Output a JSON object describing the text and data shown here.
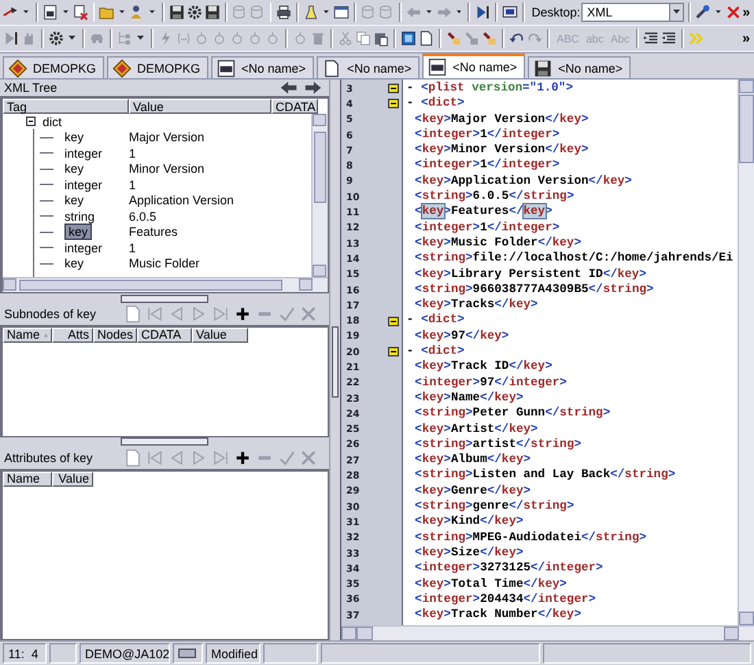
{
  "toolbar": {
    "desktop_label": "Desktop:",
    "desktop_value": "XML",
    "case_buttons": [
      {
        "label": "ABC",
        "disabled": true
      },
      {
        "label": "abc",
        "disabled": true
      },
      {
        "label": "Abc",
        "disabled": true
      }
    ],
    "overflow": [
      "»",
      "»"
    ]
  },
  "tabs": [
    {
      "label": "DEMOPKG",
      "kind": "package",
      "selected": false
    },
    {
      "label": "DEMOPKG",
      "kind": "package",
      "selected": false
    },
    {
      "label": "<No name>",
      "kind": "xml",
      "selected": false
    },
    {
      "label": "<No name>",
      "kind": "document",
      "selected": false
    },
    {
      "label": "<No name>",
      "kind": "xml",
      "selected": true
    },
    {
      "label": "<No name>",
      "kind": "database",
      "selected": false
    }
  ],
  "xml_tree": {
    "title": "XML Tree",
    "columns": [
      "Tag",
      "Value",
      "CDATA"
    ],
    "nodes": [
      {
        "tag": "dict",
        "expanded": true,
        "selected": false,
        "children": [
          {
            "tag": "key",
            "value": "Major Version",
            "selected": false
          },
          {
            "tag": "integer",
            "value": "1",
            "selected": false
          },
          {
            "tag": "key",
            "value": "Minor Version",
            "selected": false
          },
          {
            "tag": "integer",
            "value": "1",
            "selected": false
          },
          {
            "tag": "key",
            "value": "Application Version",
            "selected": false
          },
          {
            "tag": "string",
            "value": "6.0.5",
            "selected": false
          },
          {
            "tag": "key",
            "value": "Features",
            "selected": true
          },
          {
            "tag": "integer",
            "value": "1",
            "selected": false
          },
          {
            "tag": "key",
            "value": "Music Folder",
            "selected": false
          }
        ]
      }
    ]
  },
  "subnodes": {
    "title": "Subnodes of key",
    "columns": [
      {
        "label": "Name",
        "sorted": true
      },
      {
        "label": "Atts",
        "sorted": false
      },
      {
        "label": "Nodes",
        "sorted": false
      },
      {
        "label": "CDATA",
        "sorted": false
      },
      {
        "label": "Value",
        "sorted": false
      }
    ]
  },
  "attributes": {
    "title": "Attributes of key",
    "columns": [
      {
        "label": "Name",
        "sorted": false
      },
      {
        "label": "Value",
        "sorted": false
      }
    ]
  },
  "editor": {
    "lines": [
      {
        "number": "3",
        "text": "- <plist version=\"1.0\">",
        "collapsible": true,
        "match": false
      },
      {
        "number": "4",
        "text": "- <dict>",
        "collapsible": true,
        "match": false
      },
      {
        "number": "5",
        "text": "<key>Major Version</key>",
        "collapsible": false,
        "match": false
      },
      {
        "number": "6",
        "text": "<integer>1</integer>",
        "collapsible": false,
        "match": false
      },
      {
        "number": "7",
        "text": "<key>Minor Version</key>",
        "collapsible": false,
        "match": false
      },
      {
        "number": "8",
        "text": "<integer>1</integer>",
        "collapsible": false,
        "match": false
      },
      {
        "number": "9",
        "text": "<key>Application Version</key>",
        "collapsible": false,
        "match": false
      },
      {
        "number": "10",
        "text": "<string>6.0.5</string>",
        "collapsible": false,
        "match": false
      },
      {
        "number": "11",
        "text": "<key>Features</key>",
        "collapsible": false,
        "match": true
      },
      {
        "number": "12",
        "text": "<integer>1</integer>",
        "collapsible": false,
        "match": false
      },
      {
        "number": "13",
        "text": "<key>Music Folder</key>",
        "collapsible": false,
        "match": false
      },
      {
        "number": "14",
        "text": "<string>file://localhost/C:/home/jahrends/Ei",
        "collapsible": false,
        "match": false
      },
      {
        "number": "15",
        "text": "<key>Library Persistent ID</key>",
        "collapsible": false,
        "match": false
      },
      {
        "number": "16",
        "text": "<string>966038777A4309B5</string>",
        "collapsible": false,
        "match": false
      },
      {
        "number": "17",
        "text": "<key>Tracks</key>",
        "collapsible": false,
        "match": false
      },
      {
        "number": "18",
        "text": "- <dict>",
        "collapsible": true,
        "match": false
      },
      {
        "number": "19",
        "text": "<key>97</key>",
        "collapsible": false,
        "match": false
      },
      {
        "number": "20",
        "text": "- <dict>",
        "collapsible": true,
        "match": false
      },
      {
        "number": "21",
        "text": "<key>Track ID</key>",
        "collapsible": false,
        "match": false
      },
      {
        "number": "22",
        "text": "<integer>97</integer>",
        "collapsible": false,
        "match": false
      },
      {
        "number": "23",
        "text": "<key>Name</key>",
        "collapsible": false,
        "match": false
      },
      {
        "number": "24",
        "text": "<string>Peter Gunn</string>",
        "collapsible": false,
        "match": false
      },
      {
        "number": "25",
        "text": "<key>Artist</key>",
        "collapsible": false,
        "match": false
      },
      {
        "number": "26",
        "text": "<string>artist</string>",
        "collapsible": false,
        "match": false
      },
      {
        "number": "27",
        "text": "<key>Album</key>",
        "collapsible": false,
        "match": false
      },
      {
        "number": "28",
        "text": "<string>Listen and Lay Back</string>",
        "collapsible": false,
        "match": false
      },
      {
        "number": "29",
        "text": "<key>Genre</key>",
        "collapsible": false,
        "match": false
      },
      {
        "number": "30",
        "text": "<string>genre</string>",
        "collapsible": false,
        "match": false
      },
      {
        "number": "31",
        "text": "<key>Kind</key>",
        "collapsible": false,
        "match": false
      },
      {
        "number": "32",
        "text": "<string>MPEG-Audiodatei</string>",
        "collapsible": false,
        "match": false
      },
      {
        "number": "33",
        "text": "<key>Size</key>",
        "collapsible": false,
        "match": false
      },
      {
        "number": "34",
        "text": "<integer>3273125</integer>",
        "collapsible": false,
        "match": false
      },
      {
        "number": "35",
        "text": "<key>Total Time</key>",
        "collapsible": false,
        "match": false
      },
      {
        "number": "36",
        "text": "<integer>204434</integer>",
        "collapsible": false,
        "match": false
      },
      {
        "number": "37",
        "text": "<key>Track Number</key>",
        "collapsible": false,
        "match": false
      }
    ]
  },
  "status_bar": {
    "position": "11:  4",
    "user": "DEMO@JA102",
    "state": "Modified"
  }
}
